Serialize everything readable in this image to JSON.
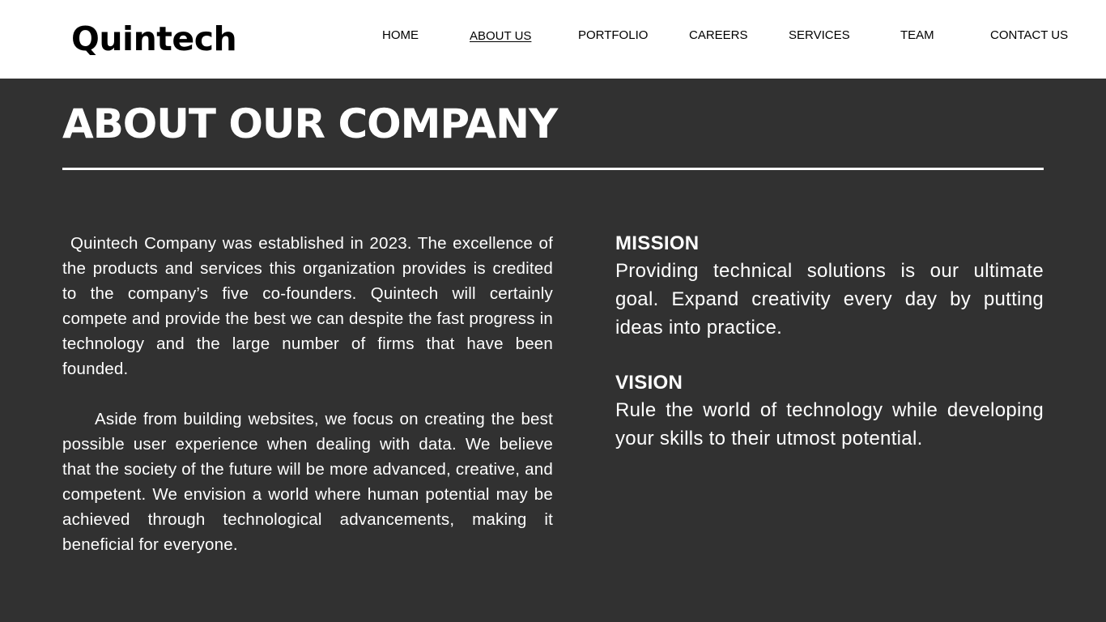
{
  "header": {
    "logo": "Quintech",
    "nav": [
      {
        "label": "HOME"
      },
      {
        "label": "ABOUT US",
        "active": true
      },
      {
        "label": "PORTFOLIO"
      },
      {
        "label": "CAREERS"
      },
      {
        "label": "SERVICES"
      },
      {
        "label": "TEAM"
      },
      {
        "label": "CONTACT US"
      }
    ]
  },
  "main": {
    "title": "ABOUT OUR COMPANY",
    "about_paragraphs": [
      "Quintech Company was established in 2023. The excellence of the products and services this organization provides is credited to the company’s five co-founders. Quintech will certainly compete and provide the best we can despite the fast progress in technology and the large number of firms that have been founded.",
      "Aside from building websites, we focus on creating the best possible user experience when dealing with data. We believe that the society of the future will be more advanced, creative, and competent. We envision a world where human potential may be achieved through technological advancements, making it beneficial for everyone."
    ],
    "mission": {
      "heading": "MISSION",
      "text": "Providing technical solutions is our ultimate goal. Expand creativity every day by putting ideas into practice."
    },
    "vision": {
      "heading": "VISION",
      "text": "Rule the world of technology while developing your skills to their utmost potential."
    }
  },
  "colors": {
    "header_bg": "#ffffff",
    "page_bg": "#313131",
    "text_light": "#ffffff",
    "text_dark": "#000000"
  }
}
